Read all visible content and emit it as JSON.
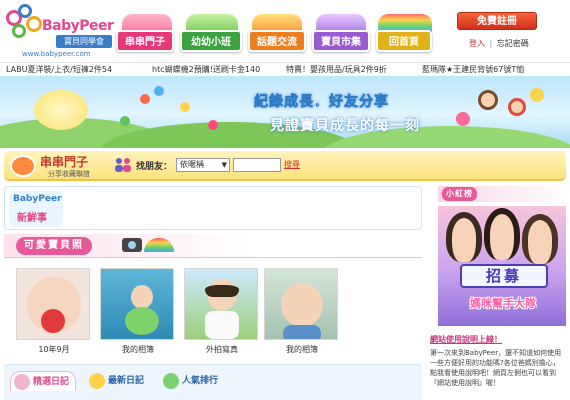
{
  "logo": {
    "brand": "BabyPeer",
    "subtitle": "寶貝同學會",
    "url": "www.babypeer.com"
  },
  "nav": {
    "tabs": [
      "串串門子",
      "幼幼小班",
      "話題交流",
      "寶貝市集",
      "回首頁"
    ],
    "colors": [
      "#e9387a",
      "#3aa33f",
      "#ee7f1e",
      "#9b5bd0",
      "#e2b21a"
    ]
  },
  "account": {
    "register": "免費註冊",
    "login": "登入",
    "separator": "|",
    "forgot": "忘記密碼"
  },
  "ticker": [
    "LABU夏洋裝/上衣/短褲2件54",
    "htc蝴蝶機2預購!送刷卡金140",
    "特賣！嬰孩用品/玩具2件9折",
    "藍瑪隊★王建民背號67號T恤"
  ],
  "banner": {
    "line1": "紀錄成長．好友分享",
    "line2": "見證寶貝成長的每一刻"
  },
  "friend_bar": {
    "title": "串串門子",
    "subtitle": "分享收藏聯誼",
    "label": "找朋友：",
    "select_value": "依暱稱",
    "search_link": "搜尋"
  },
  "fresh": {
    "brand": "BabyPeer",
    "title": "新鮮事"
  },
  "gallery": {
    "title": "可愛寶貝照",
    "photos": [
      {
        "caption": "10年9月"
      },
      {
        "caption": "我的相簿"
      },
      {
        "caption": "外拍寫真"
      },
      {
        "caption": "我的相簿"
      }
    ]
  },
  "tabs": [
    "精選日記",
    "最新日記",
    "人氣排行"
  ],
  "sidebar": {
    "title": "小紅榜",
    "ad_big": "招募",
    "ad_sub": "媽咪幫手大隊",
    "site_title": "網站使用說明上線！",
    "site_desc": "第一次來到BabyPeer，還不知道如何使用一些方便好用的功能嗎?各位爸媽別擔心，點我看使用說明吧！網頁左側也可以看到『網站使用說明』喔！"
  }
}
